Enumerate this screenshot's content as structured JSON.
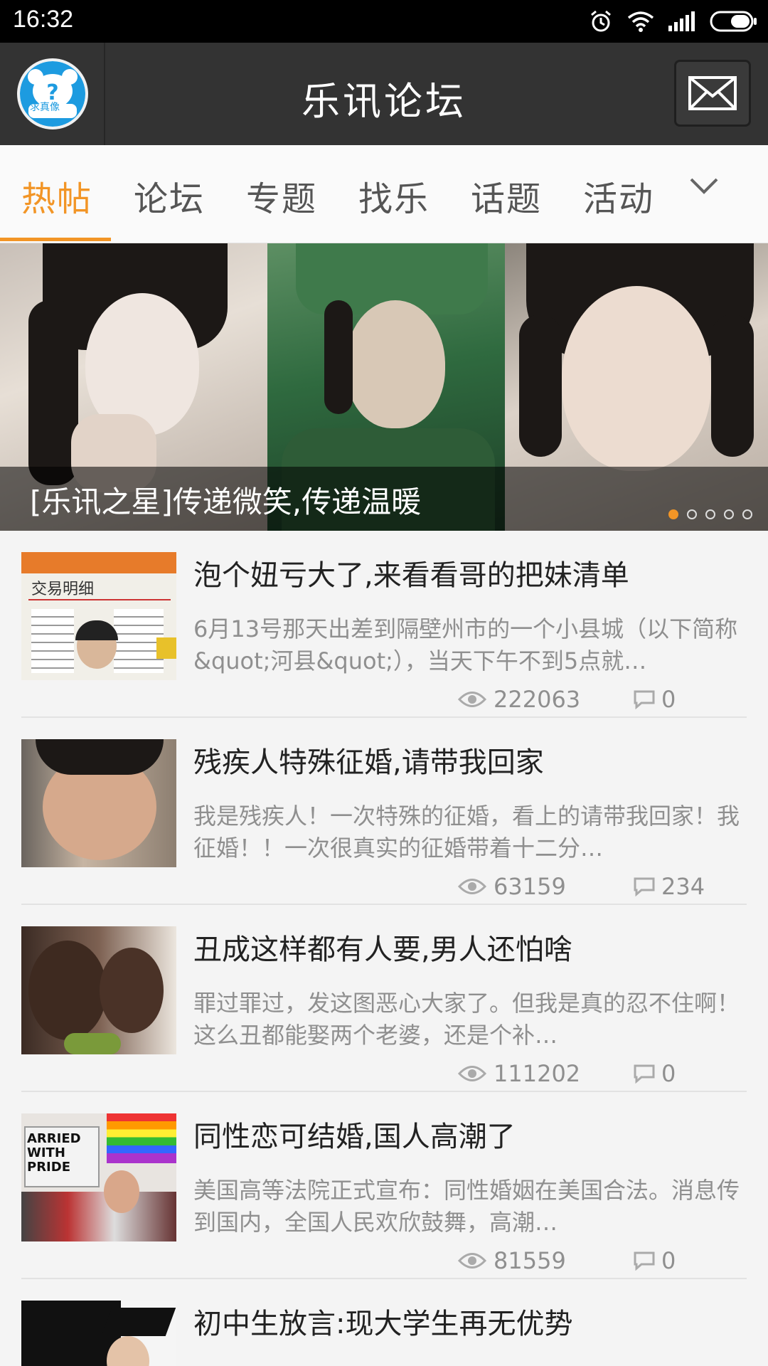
{
  "status_bar": {
    "time": "16:32"
  },
  "header": {
    "title": "乐讯论坛",
    "avatar_text": "求真像"
  },
  "tabs": [
    {
      "label": "热帖",
      "active": true
    },
    {
      "label": "论坛",
      "active": false
    },
    {
      "label": "专题",
      "active": false
    },
    {
      "label": "找乐",
      "active": false
    },
    {
      "label": "话题",
      "active": false
    },
    {
      "label": "活动",
      "active": false
    }
  ],
  "banner": {
    "caption": "[乐讯之星]传递微笑,传递温暖",
    "slide_count": 5,
    "active_slide": 1
  },
  "posts": [
    {
      "title": "泡个妞亏大了,来看看哥的把妹清单",
      "desc": "6月13号那天出差到隔壁州市的一个小县城（以下简称&quot;河县&quot;），当天下午不到5点就…",
      "views": "222063",
      "comments": "0",
      "thumb_text": "交易明细"
    },
    {
      "title": "残疾人特殊征婚,请带我回家",
      "desc": "我是残疾人！一次特殊的征婚，看上的请带我回家！我征婚！！一次很真实的征婚带着十二分…",
      "views": "63159",
      "comments": "234"
    },
    {
      "title": "丑成这样都有人要,男人还怕啥",
      "desc": "罪过罪过，发这图恶心大家了。但我是真的忍不住啊！这么丑都能娶两个老婆，还是个补…",
      "views": "111202",
      "comments": "0"
    },
    {
      "title": "同性恋可结婚,国人高潮了",
      "desc": "美国高等法院正式宣布：同性婚姻在美国合法。消息传到国内，全国人民欢欣鼓舞，高潮…",
      "views": "81559",
      "comments": "0",
      "thumb_text": "ARRIED WITH PRIDE"
    },
    {
      "title": "初中生放言:现大学生再无优势"
    }
  ],
  "colors": {
    "accent": "#f29526",
    "header_bg": "#333333"
  }
}
